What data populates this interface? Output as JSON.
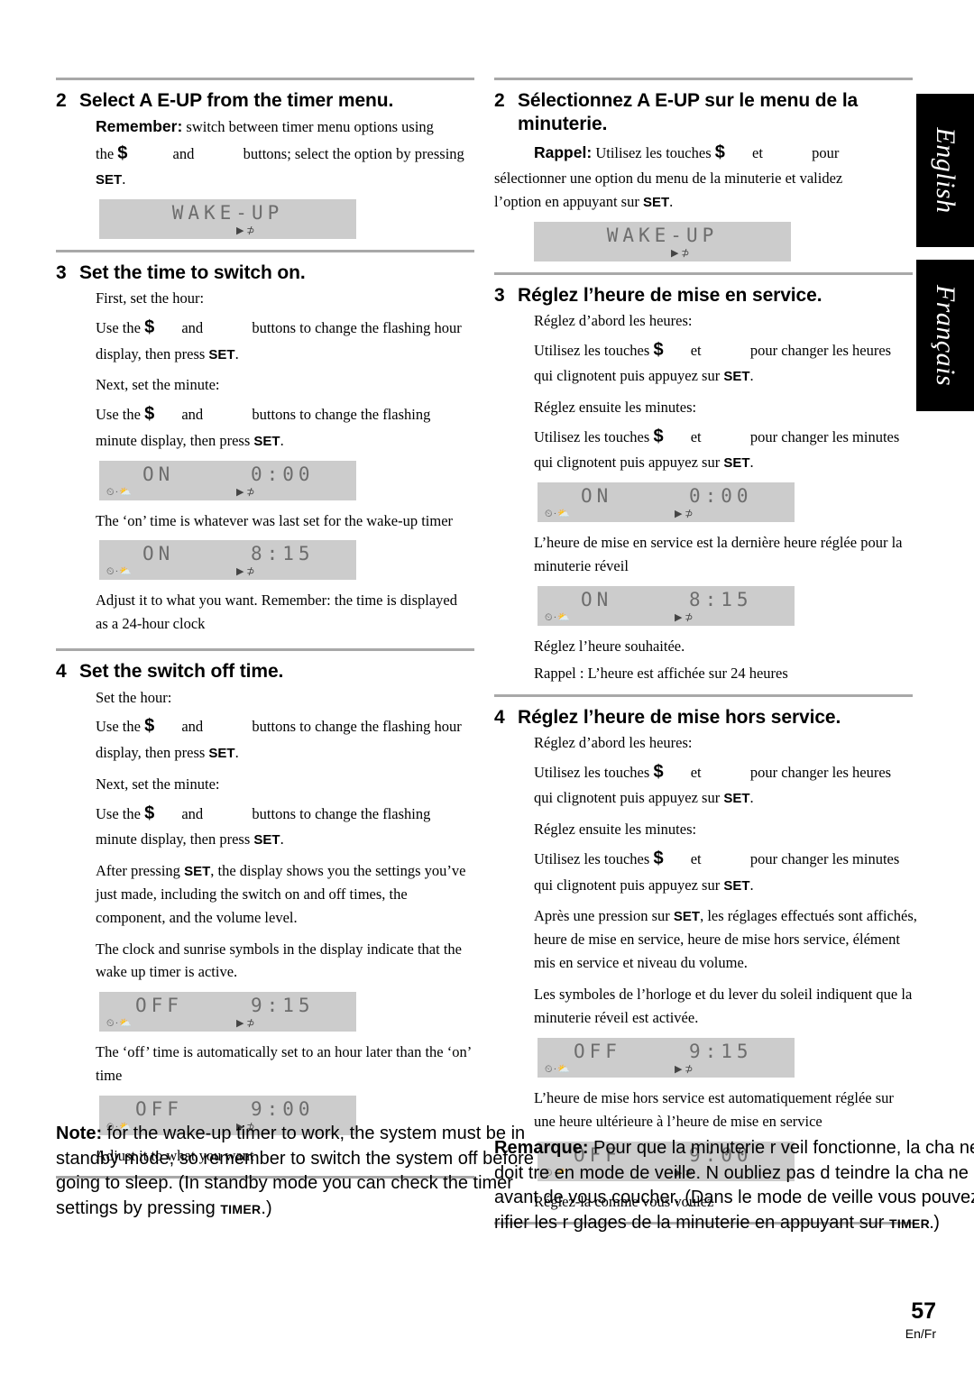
{
  "tabs": {
    "english": "English",
    "francais": "Français"
  },
  "footer": {
    "page_number": "57",
    "languages": "En/Fr"
  },
  "lcd": {
    "wakeup_label": "WAKE-UP",
    "on_label": "ON",
    "off_label": "OFF",
    "time_0_00": "0:00",
    "time_8_15": "8:15",
    "time_9_15": "9:15",
    "time_9_00": "9:00",
    "icons": "⏲·⛅",
    "indicator": "▶ ⊅"
  },
  "english": {
    "step2": {
      "number": "2",
      "title": "Select  A E-UP from the timer menu.",
      "remember_label": "Remember:",
      "remember_text_1": " switch between timer menu options using",
      "remember_text_2": "the ",
      "remember_text_3": " and ",
      "remember_text_4": " buttons; select the option by pressing",
      "remember_set": "SET",
      "remember_period": "."
    },
    "step3": {
      "number": "3",
      "title": "Set the time to switch on.",
      "line1": "First, set the hour:",
      "line2_a": "Use the ",
      "line2_b": " and ",
      "line2_c": " buttons to change the flashing hour",
      "line2_d": "display, then press ",
      "line2_set": "SET",
      "line2_end": ".",
      "line3": "Next, set the minute:",
      "line4_c": " buttons to change the flashing",
      "line4_d": "minute display, then press ",
      "caption1": "The ‘on’ time is whatever was last set for the wake-up timer",
      "caption2_a": "Adjust it to what you want. Remember: the time is displayed",
      "caption2_b": "as a 24-hour clock"
    },
    "step4": {
      "number": "4",
      "title": "Set the switch off time.",
      "line1": "Set the hour:",
      "line2_c": " buttons to change the flashing hour",
      "line2_d": "display, then press ",
      "line3": "Next, set the minute:",
      "line4_c": " buttons to change the flashing",
      "line4_d": "minute display, then press ",
      "para1_a": "After pressing ",
      "para1_set": "SET",
      "para1_b": ", the display shows you the settings you’ve just made, including the switch on and off times, the component, and the volume level.",
      "para2": "The clock and sunrise symbols in the display indicate that the wake up timer is active.",
      "caption1": "The ‘off’ time is automatically set to an hour later than the ‘on’ time",
      "caption2": "Adjust it to what you want"
    },
    "note": {
      "label": "Note:",
      "text": " for the wake-up timer to work, the system must be in standby mode, so remember to switch the system off before going to sleep. (In standby mode you can check the timer settings by pressing ",
      "timer_button": "TIMER",
      "end": ".)"
    }
  },
  "francais": {
    "step2": {
      "number": "2",
      "title": "Sélectionnez  A E-UP sur le menu de la minuterie.",
      "rappel_label": "Rappel:",
      "rappel_text_1": " Utilisez les touches ",
      "rappel_text_2": " et ",
      "rappel_text_3": " pour",
      "rappel_text_4": "sélectionner une option du menu de la minuterie et validez",
      "rappel_text_5": "l’option en appuyant sur ",
      "rappel_set": "SET",
      "rappel_period": "."
    },
    "step3": {
      "number": "3",
      "title": "Réglez l’heure de mise en service.",
      "line1": "Réglez d’abord les heures:",
      "line2_a": "Utilisez les touches ",
      "line2_b": " et ",
      "line2_c": " pour changer les heures",
      "line2_d": "qui clignotent puis appuyez sur ",
      "line2_set": "SET",
      "line2_end": ".",
      "line3": "Réglez ensuite les minutes:",
      "line4_c": " pour changer les minutes",
      "line4_d": "qui clignotent puis appuyez sur ",
      "caption1_a": "L’heure de mise en service est la dernière heure réglée pour la",
      "caption1_b": "minuterie réveil",
      "caption2": "Réglez l’heure souhaitée.",
      "caption3": "Rappel : L’heure est affichée sur 24 heures"
    },
    "step4": {
      "number": "4",
      "title": "Réglez l’heure de mise hors service.",
      "line1": "Réglez d’abord les heures:",
      "line2_c": " pour changer les heures",
      "line2_d": "qui clignotent puis appuyez sur ",
      "line3": "Réglez ensuite les minutes:",
      "line4_c": " pour changer les minutes",
      "line4_d": "qui clignotent puis appuyez sur ",
      "para1_a": "Après une pression sur ",
      "para1_set": "SET",
      "para1_b": ", les réglages effectués sont affichés, heure de mise en service, heure de mise hors service, élément mis en service et niveau du volume.",
      "para2": "Les symboles de l’horloge et du lever du soleil indiquent que la minuterie réveil est activée.",
      "caption1_a": "L’heure de mise hors service est automatiquement réglée sur",
      "caption1_b": "une heure ultérieure à l’heure de mise en service",
      "caption2": "Réglez-la comme vous voulez"
    },
    "note": {
      "label": "Remarque:",
      "text": " Pour que la minuterie r veil fonctionne, la cha ne doit  tre en mode de veille. N oubliez pas d  teindre la cha ne avant de vous coucher. (Dans le mode de veille vous pouvez v rifier les r glages de la minuterie en appuyant sur",
      "timer_button": "TIMER.",
      "end": ")"
    }
  }
}
